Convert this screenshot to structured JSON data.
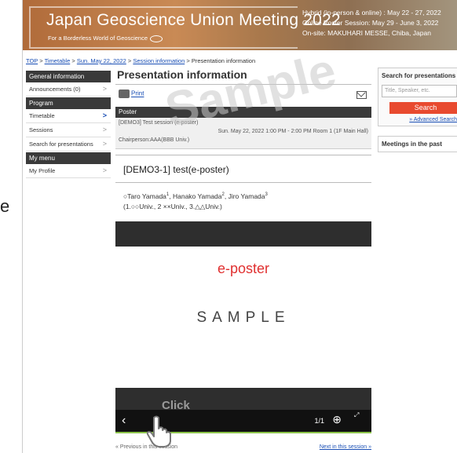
{
  "left_fragment": "e",
  "banner": {
    "title": "Japan Geoscience Union Meeting 2022",
    "subtitle": "For a Borderless World of Geoscience",
    "info_line1": "Hybrid (in-person & online) : May 22 - 27, 2022",
    "info_line2": "Online Poster Session: May 29 - June 3, 2022",
    "info_line3": "On-site: MAKUHARI MESSE, Chiba, Japan"
  },
  "breadcrumb": {
    "top": "TOP",
    "timetable": "Timetable",
    "date": "Sun. May 22, 2022",
    "session_info": "Session information",
    "current": "Presentation information",
    "separator": ">"
  },
  "nav": {
    "general_header": "General information",
    "announcements": "Announcements (0)",
    "program_header": "Program",
    "timetable": "Timetable",
    "sessions": "Sessions",
    "search": "Search for presentations",
    "mymenu_header": "My menu",
    "profile": "My Profile",
    "chevron": ">"
  },
  "main": {
    "title": "Presentation information",
    "print_label": "Print",
    "session_type": "Poster",
    "session_name": "[DEMO3] Test session (e-poster)",
    "session_time": "Sun. May 22, 2022 1:00 PM - 2:00 PM Room 1 (1F Main Hall)",
    "chairperson": "Chairperson:AAA(BBB Univ.)",
    "presentation_title": "[DEMO3-1] test(e-poster)",
    "authors_line1_a": "○Taro Yamada",
    "sup1": "1",
    "authors_line1_b": ", Hanako Yamada",
    "sup2": "2",
    "authors_line1_c": ", Jiro Yamada",
    "sup3": "3",
    "authors_line2": "(1.○○Univ., 2 ××Univ., 3.△△Univ.)"
  },
  "viewer": {
    "eposter_label": "e-poster",
    "sample_text": "SAMPLE",
    "prev_icon": "‹",
    "page_indicator": "1/1",
    "zoom_icon": "⊕",
    "fullscreen_icon": "⤢"
  },
  "pager": {
    "previous": "« Previous in this session",
    "next": "Next in this session »"
  },
  "sidebar_right": {
    "search_heading": "Search for presentations",
    "search_placeholder": "Title, Speaker, etc.",
    "search_button": "Search",
    "advanced": "» Advanced Search",
    "meetings_past": "Meetings in the past"
  },
  "overlay": {
    "watermark": "Sample",
    "click_label": "Click"
  },
  "colors": {
    "accent_red": "#e84a2f",
    "nav_dark": "#3a3a3a",
    "link_blue": "#1a4fb5",
    "eposter_red": "#e03030"
  }
}
